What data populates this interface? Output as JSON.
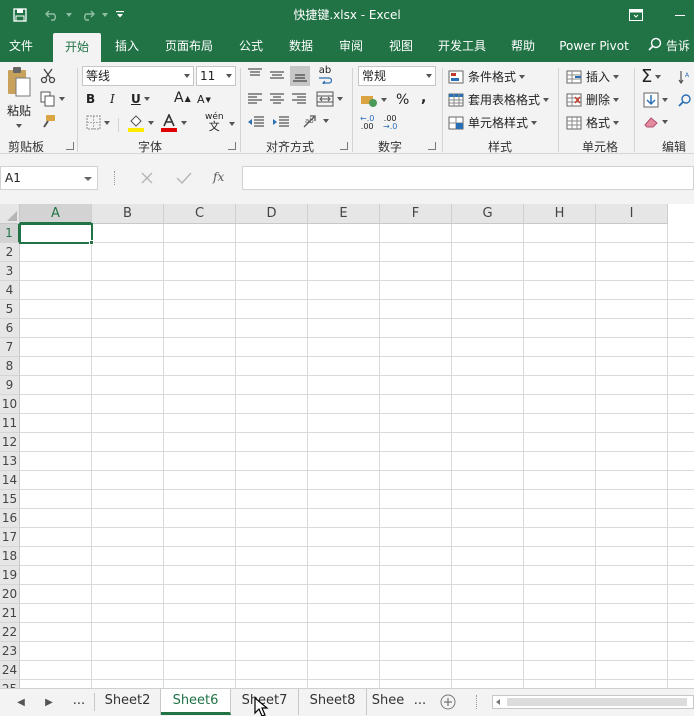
{
  "titlebar": {
    "title": "快捷键.xlsx  -  Excel"
  },
  "ribbon_tabs": [
    "文件",
    "开始",
    "插入",
    "页面布局",
    "公式",
    "数据",
    "审阅",
    "视图",
    "开发工具",
    "帮助",
    "Power Pivot",
    "告诉"
  ],
  "active_tab": "开始",
  "clipboard": {
    "paste_label": "粘贴",
    "group_label": "剪贴板"
  },
  "font": {
    "font_name": "等线",
    "font_size": "11",
    "bold": "B",
    "italic": "I",
    "underline": "U",
    "grow": "A",
    "shrink": "A",
    "phonetic": "wén",
    "group_label": "字体"
  },
  "alignment": {
    "wrap": "ab",
    "group_label": "对齐方式"
  },
  "number": {
    "format": "常规",
    "percent": "%",
    "comma": ",",
    "inc_decimal": ".00",
    "dec_decimal": ".00",
    "group_label": "数字"
  },
  "styles": {
    "conditional": "条件格式",
    "table": "套用表格格式",
    "cell_styles": "单元格样式",
    "group_label": "样式"
  },
  "cells": {
    "insert": "插入",
    "delete": "删除",
    "format": "格式",
    "group_label": "单元格"
  },
  "editing": {
    "group_label": "编辑"
  },
  "formula_bar": {
    "name_box": "A1",
    "fx": "fx",
    "value": ""
  },
  "grid": {
    "columns": [
      "A",
      "B",
      "C",
      "D",
      "E",
      "F",
      "G",
      "H",
      "I"
    ],
    "rows": [
      "1",
      "2",
      "3",
      "4",
      "5",
      "6",
      "7",
      "8",
      "9",
      "10",
      "11",
      "12",
      "13",
      "14",
      "15",
      "16",
      "17",
      "18",
      "19",
      "20",
      "21",
      "22",
      "23",
      "24",
      "25"
    ],
    "selected_column": "A",
    "selected_row": "1"
  },
  "sheets": {
    "ellipsis": "...",
    "tabs": [
      "Sheet2",
      "Sheet6",
      "Sheet7",
      "Sheet8",
      "Shee"
    ],
    "active": "Sheet6",
    "more": "..."
  },
  "colors": {
    "brand": "#217346",
    "font_color": "#e00000",
    "highlight": "#ffeb00"
  }
}
